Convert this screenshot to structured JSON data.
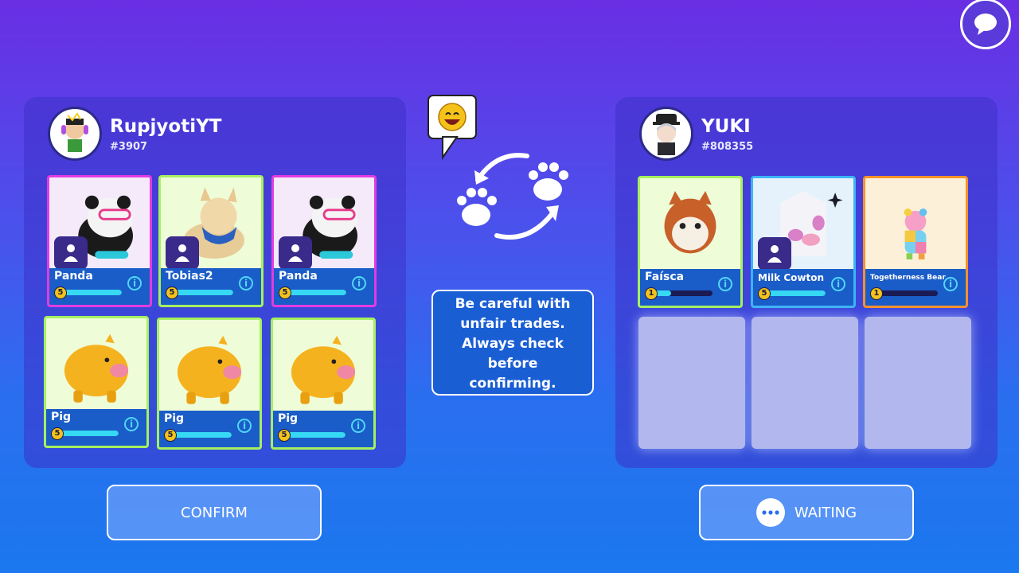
{
  "left_player": {
    "name": "RupjyotiYT",
    "tag": "#3907",
    "items": [
      {
        "name": "Panda",
        "level": "5",
        "progress": 1.0,
        "rarity": "pink",
        "art": "panda"
      },
      {
        "name": "Tobias2",
        "level": "5",
        "progress": 1.0,
        "rarity": "green",
        "art": "dog"
      },
      {
        "name": "Panda",
        "level": "5",
        "progress": 1.0,
        "rarity": "pink",
        "art": "panda"
      },
      {
        "name": "Pig",
        "level": "5",
        "progress": 1.0,
        "rarity": "green",
        "art": "pig"
      },
      {
        "name": "Pig",
        "level": "5",
        "progress": 1.0,
        "rarity": "green",
        "art": "pig"
      },
      {
        "name": "Pig",
        "level": "5",
        "progress": 1.0,
        "rarity": "green",
        "art": "pig"
      }
    ]
  },
  "right_player": {
    "name": "YUKI",
    "tag": "#808355",
    "items": [
      {
        "name": "Faísca",
        "level": "1",
        "progress": 0.3,
        "rarity": "green",
        "art": "fox"
      },
      {
        "name": "Milk Cowton",
        "level": "5",
        "progress": 1.0,
        "rarity": "blue",
        "art": "milk"
      },
      {
        "name": "Togetherness Bear",
        "level": "1",
        "progress": 0.0,
        "rarity": "orange",
        "art": "bear"
      }
    ]
  },
  "warning": {
    "lines": [
      "Be careful with",
      "unfair trades.",
      "Always check",
      "before",
      "confirming."
    ]
  },
  "buttons": {
    "confirm": "CONFIRM",
    "waiting": "WAITING"
  },
  "colors": {
    "accent": "#36d8f4",
    "bar": "#1a5cc8",
    "border_green": "#a6f060",
    "border_pink": "#e23ce0",
    "border_blue": "#3cb4f8",
    "border_orange": "#f5922a"
  }
}
